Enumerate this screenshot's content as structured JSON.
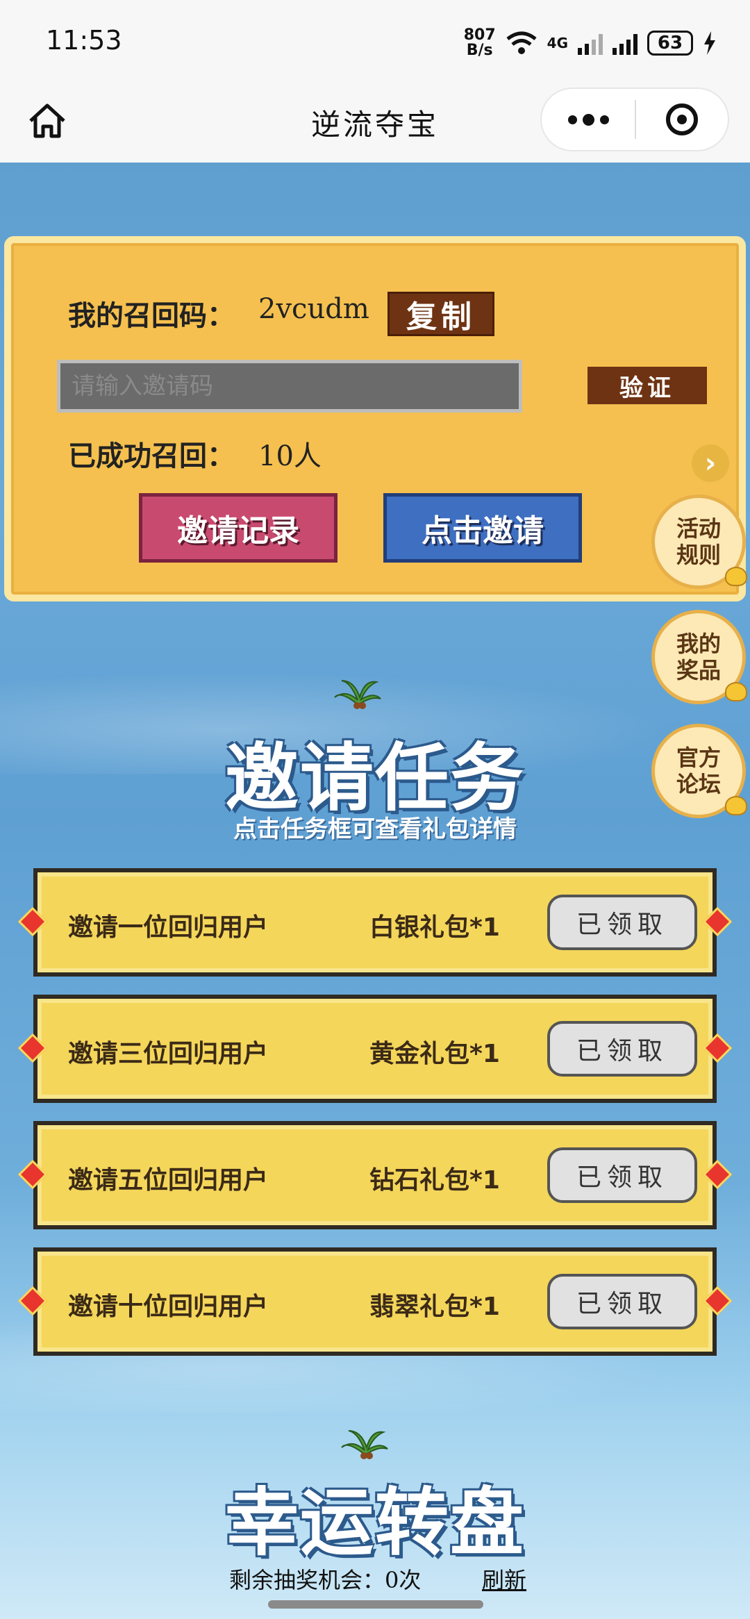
{
  "status_bar": {
    "time": "11:53",
    "speed_value": "807",
    "speed_unit": "B/s",
    "network": "4G",
    "battery": "63"
  },
  "nav": {
    "title": "逆流夺宝"
  },
  "recall": {
    "code_label": "我的召回码：",
    "code_value": "2vcudm",
    "copy_label": "复制",
    "input_placeholder": "请输入邀请码",
    "verify_label": "验证",
    "recalled_label": "已成功召回：",
    "recalled_value": "10人",
    "record_label": "邀请记录",
    "invite_label": "点击邀请"
  },
  "side_buttons": {
    "rules": "活动\n规则",
    "prizes": "我的\n奖品",
    "forum": "官方\n论坛"
  },
  "tasks_section": {
    "title": "邀请任务",
    "subtitle": "点击任务框可查看礼包详情",
    "tasks": [
      {
        "name": "邀请一位回归用户",
        "reward": "白银礼包*1",
        "status": "已领取"
      },
      {
        "name": "邀请三位回归用户",
        "reward": "黄金礼包*1",
        "status": "已领取"
      },
      {
        "name": "邀请五位回归用户",
        "reward": "钻石礼包*1",
        "status": "已领取"
      },
      {
        "name": "邀请十位回归用户",
        "reward": "翡翠礼包*1",
        "status": "已领取"
      }
    ]
  },
  "wheel_section": {
    "title": "幸运转盘",
    "remaining_text": "剩余抽奖机会：0次",
    "refresh_label": "刷新"
  },
  "colors": {
    "card_gold": "#f5c04f",
    "brown_button": "#6e3313",
    "pink_button": "#c94a6f",
    "blue_button": "#3e6fc1",
    "sky_blue": "#5f9fd0"
  }
}
